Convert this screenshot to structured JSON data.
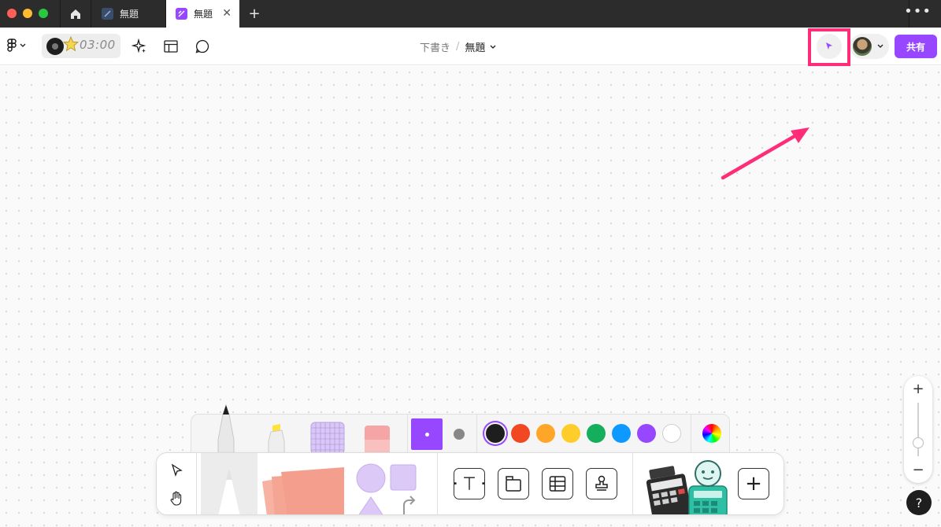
{
  "titlebar": {
    "tabs": [
      {
        "label": "無題",
        "active": false
      },
      {
        "label": "無題",
        "active": true
      }
    ],
    "close_glyph": "✕",
    "new_tab_glyph": "+",
    "more_glyph": "•••"
  },
  "toolbar": {
    "timer": "03:00",
    "breadcrumb": {
      "drafts": "下書き",
      "separator": "/",
      "file": "無題"
    },
    "share_label": "共有",
    "icons": [
      "figjam-logo-icon",
      "chevron-down-icon",
      "sparkle-icon",
      "layout-icon",
      "comment-icon",
      "cursor-icon"
    ]
  },
  "zoom": {
    "plus": "+",
    "minus": "−",
    "level": 0.25
  },
  "help": {
    "label": "?"
  },
  "tray": {
    "colors": [
      "#1e1e1e",
      "#f24822",
      "#ffa629",
      "#ffcd29",
      "#14ae5c",
      "#0d99ff",
      "#9747ff",
      "#ffffff"
    ],
    "selected_color": "#1e1e1e"
  },
  "bottom_bar": {
    "add_glyph": "+",
    "tools": [
      "select-icon",
      "hand-icon",
      "text-icon",
      "section-icon",
      "table-icon",
      "stamp-icon"
    ]
  },
  "accent": "#9747ff",
  "highlight_color": "#ff2d78"
}
